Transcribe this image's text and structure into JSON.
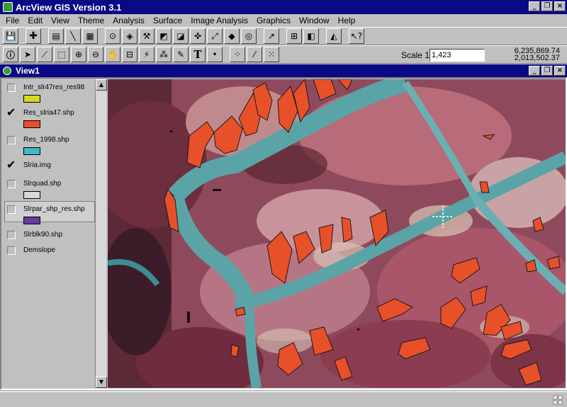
{
  "app": {
    "title": "ArcView GIS Version 3.1"
  },
  "menu": [
    "File",
    "Edit",
    "View",
    "Theme",
    "Analysis",
    "Surface",
    "Image Analysis",
    "Graphics",
    "Window",
    "Help"
  ],
  "toolbar": {
    "scale_label": "Scale 1:",
    "scale_value": "1,423",
    "coord_x": "6,235,869.74",
    "coord_y": "2,013,502.37"
  },
  "view": {
    "title": "View1"
  },
  "layers": [
    {
      "name": "Intr_slr47res_res98",
      "checked": false,
      "color": "#d8d820"
    },
    {
      "name": "Res_slria47.shp",
      "checked": true,
      "color": "#e8502a"
    },
    {
      "name": "Res_1998.shp",
      "checked": false,
      "color": "#40b8c8"
    },
    {
      "name": "Slria.img",
      "checked": true,
      "color": ""
    },
    {
      "name": "Slrquad.shp",
      "checked": false,
      "color": "#d8d8d8"
    },
    {
      "name": "Slrpar_shp_res.shp",
      "checked": false,
      "color": "#6a3aa0"
    },
    {
      "name": "Slrblk90.shp",
      "checked": false,
      "color": ""
    },
    {
      "name": "Demslope",
      "checked": false,
      "color": ""
    }
  ],
  "colors": {
    "title_bar": "#0a0a84",
    "polygon_fill": "#e8502a",
    "road": "#5aa4a8"
  }
}
